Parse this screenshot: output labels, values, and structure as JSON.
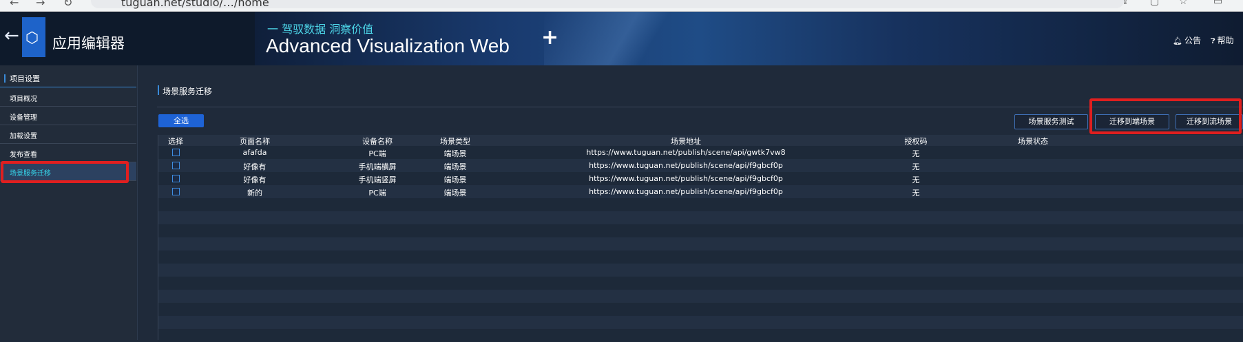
{
  "browser": {
    "url_fragment": "tuguan.net/studio/…/home"
  },
  "header": {
    "back_icon": "arrow-left-icon",
    "logo_icon": "cube-logo-icon",
    "app_title": "应用编辑器",
    "banner_subtitle": "一 驾驭数据 洞察价值",
    "banner_title": "Advanced Visualization Web",
    "notice_label": "公告",
    "help_label": "帮助"
  },
  "sidebar": {
    "group_label": "项目设置",
    "items": [
      {
        "label": "项目概况"
      },
      {
        "label": "设备管理"
      },
      {
        "label": "加载设置"
      },
      {
        "label": "发布查看"
      },
      {
        "label": "场景服务迁移"
      }
    ],
    "active_index": 4
  },
  "main": {
    "section_title": "场景服务迁移",
    "select_all_label": "全选",
    "buttons": {
      "test": "场景服务测试",
      "migrate_end": "迁移到端场景",
      "migrate_stream": "迁移到流场景"
    },
    "table": {
      "columns": [
        "选择",
        "页面名称",
        "设备名称",
        "场景类型",
        "场景地址",
        "授权码",
        "场景状态"
      ],
      "rows": [
        {
          "page": "afafda",
          "device": "PC端",
          "type": "端场景",
          "url": "https://www.tuguan.net/publish/scene/api/gwtk7vw8",
          "auth": "无",
          "status": ""
        },
        {
          "page": "好像有",
          "device": "手机端横屏",
          "type": "端场景",
          "url": "https://www.tuguan.net/publish/scene/api/f9gbcf0p",
          "auth": "无",
          "status": ""
        },
        {
          "page": "好像有",
          "device": "手机端竖屏",
          "type": "端场景",
          "url": "https://www.tuguan.net/publish/scene/api/f9gbcf0p",
          "auth": "无",
          "status": ""
        },
        {
          "page": "新的",
          "device": "PC端",
          "type": "端场景",
          "url": "https://www.tuguan.net/publish/scene/api/f9gbcf0p",
          "auth": "无",
          "status": ""
        }
      ]
    }
  },
  "colors": {
    "accent_blue": "#1e63d6",
    "active_cyan": "#36d1e6",
    "highlight_red": "#e01f1f",
    "page_bg": "#1f2a3a"
  }
}
